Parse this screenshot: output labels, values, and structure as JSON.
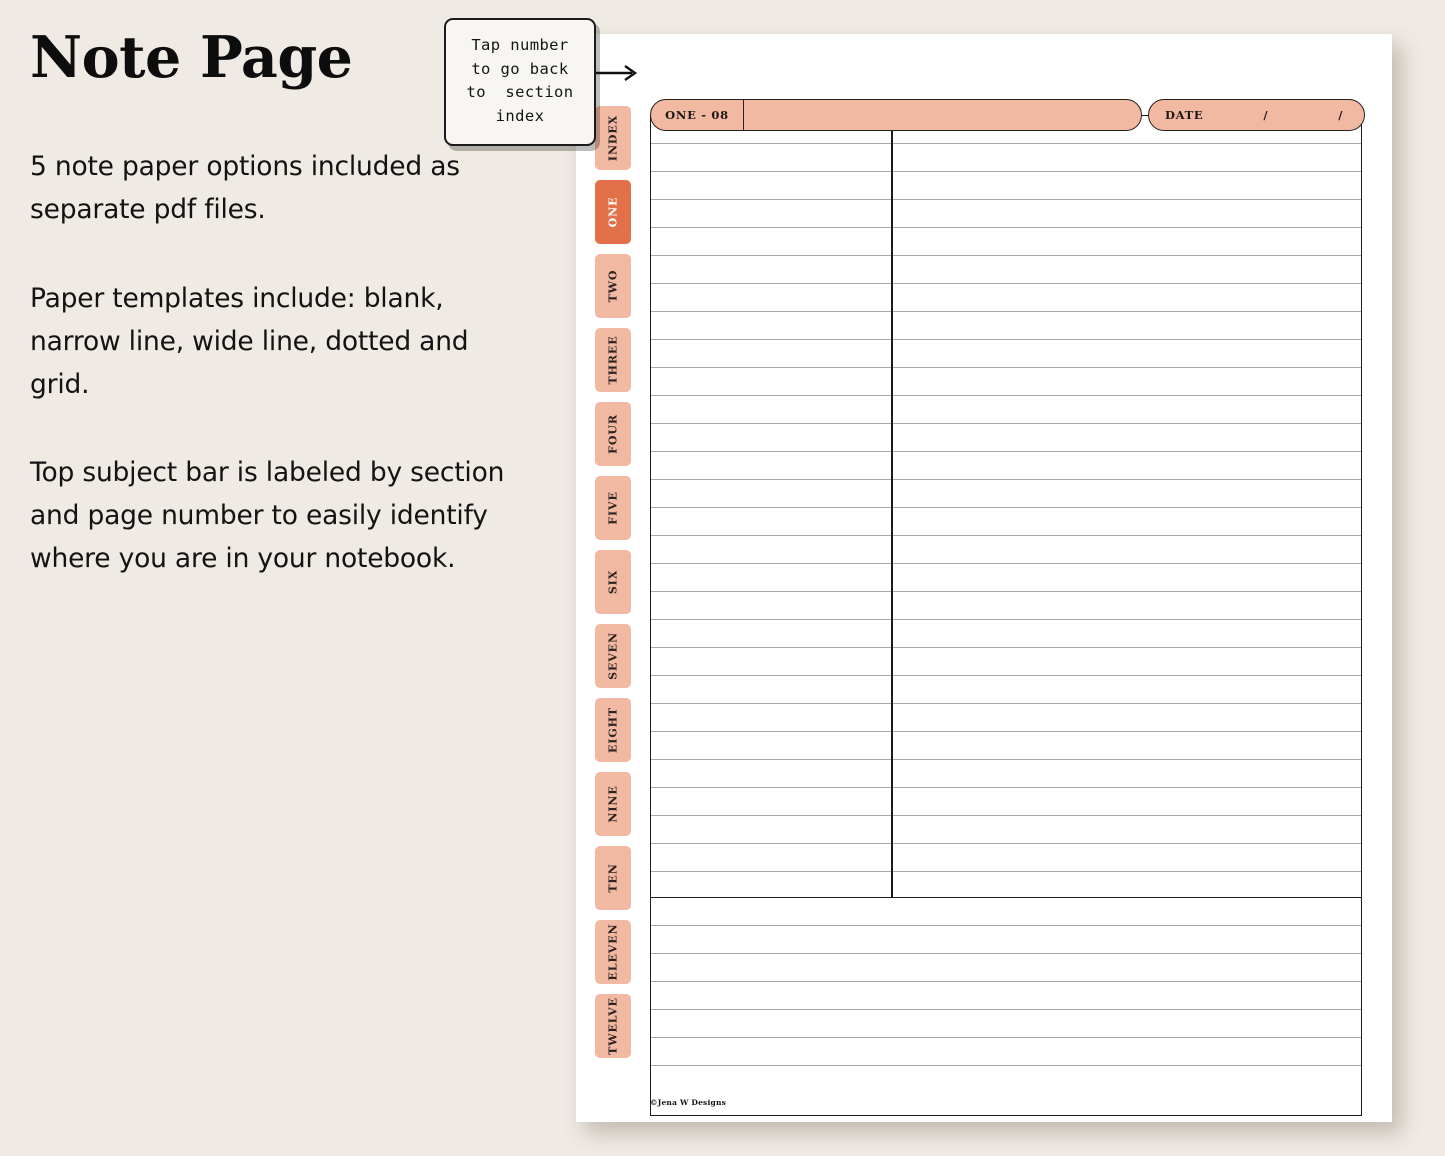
{
  "headline": "Note Page",
  "description_paragraphs": [
    "5 note paper options included\nas separate pdf files.",
    "Paper templates include:\nblank, narrow line, wide line,\ndotted and grid.",
    "Top subject bar is labeled\nby section and page number to\neasily identify where you are\nin your notebook."
  ],
  "callout": {
    "lines": [
      "Tap number",
      "to go back",
      "to  section",
      "index"
    ],
    "arrow_icon": "arrow-right-icon"
  },
  "notebook": {
    "header": {
      "subject_code": "ONE - 08",
      "subject_value": "",
      "date_label": "DATE",
      "date_slash_1": "/",
      "date_slash_2": "/"
    },
    "tabs": [
      {
        "label": "Index",
        "active": false
      },
      {
        "label": "One",
        "active": true
      },
      {
        "label": "Two",
        "active": false
      },
      {
        "label": "Three",
        "active": false
      },
      {
        "label": "Four",
        "active": false
      },
      {
        "label": "Five",
        "active": false
      },
      {
        "label": "Six",
        "active": false
      },
      {
        "label": "Seven",
        "active": false
      },
      {
        "label": "Eight",
        "active": false
      },
      {
        "label": "Nine",
        "active": false
      },
      {
        "label": "Ten",
        "active": false
      },
      {
        "label": "Eleven",
        "active": false
      },
      {
        "label": "Twelve",
        "active": false
      }
    ],
    "paper": {
      "style": "narrow line",
      "top_section_rule_count": 28,
      "bottom_section_rule_count": 7,
      "has_column_divider": true
    },
    "credit": "©Jena W Designs"
  },
  "colors": {
    "background": "#efeae3",
    "page": "#ffffff",
    "tab": "#f1b8a2",
    "tab_active": "#e2714a",
    "ink": "#1c1c1c",
    "rule": "#a8a8a8"
  }
}
